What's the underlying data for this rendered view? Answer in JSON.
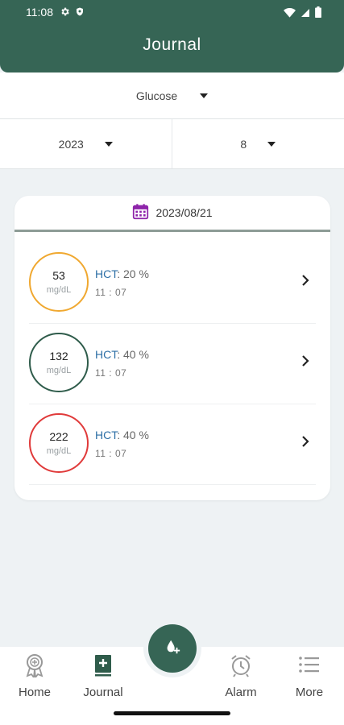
{
  "status": {
    "time": "11:08"
  },
  "header": {
    "title": "Journal"
  },
  "filters": {
    "metric": "Glucose",
    "year": "2023",
    "month": "8"
  },
  "journal": {
    "date": "2023/08/21",
    "entries": [
      {
        "value": "53",
        "unit": "mg/dL",
        "hct_label": "HCT",
        "hct_value": ": 20 %",
        "time": "11 : 07",
        "ring_color": "#f0a830"
      },
      {
        "value": "132",
        "unit": "mg/dL",
        "hct_label": "HCT",
        "hct_value": ": 40 %",
        "time": "11 : 07",
        "ring_color": "#2f5c4b"
      },
      {
        "value": "222",
        "unit": "mg/dL",
        "hct_label": "HCT",
        "hct_value": ": 40 %",
        "time": "11 : 07",
        "ring_color": "#e03a3a"
      }
    ]
  },
  "nav": {
    "home": "Home",
    "journal": "Journal",
    "alarm": "Alarm",
    "more": "More"
  },
  "colors": {
    "primary": "#366555",
    "calendar_icon": "#8e24aa",
    "hct_label": "#2d6fa6"
  }
}
